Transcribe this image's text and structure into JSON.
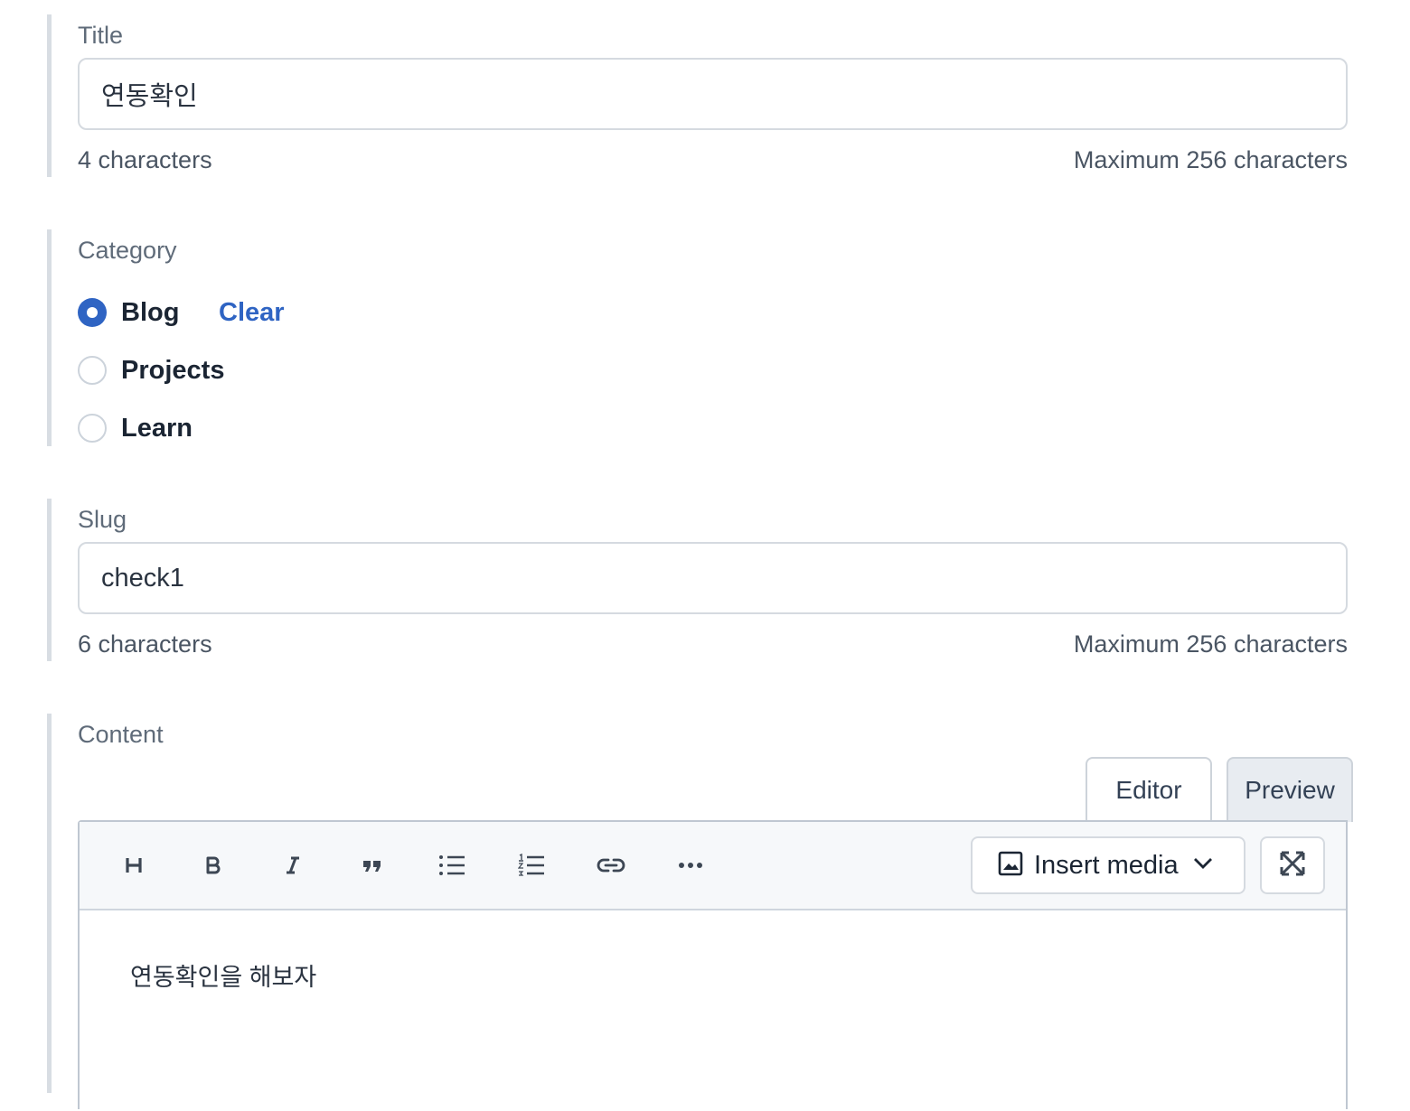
{
  "title_field": {
    "label": "Title",
    "value": "연동확인",
    "count": "4 characters",
    "max": "Maximum 256 characters"
  },
  "category_field": {
    "label": "Category",
    "options": [
      {
        "label": "Blog",
        "checked": true
      },
      {
        "label": "Projects",
        "checked": false
      },
      {
        "label": "Learn",
        "checked": false
      }
    ],
    "clear_label": "Clear"
  },
  "slug_field": {
    "label": "Slug",
    "value": "check1",
    "count": "6 characters",
    "max": "Maximum 256 characters"
  },
  "content_field": {
    "label": "Content",
    "tabs": [
      {
        "label": "Editor",
        "active": false
      },
      {
        "label": "Preview",
        "active": true
      }
    ],
    "toolbar": {
      "buttons": [
        "heading-icon",
        "bold-icon",
        "italic-icon",
        "quote-icon",
        "bullet-list-icon",
        "numbered-list-icon",
        "link-icon",
        "more-icon"
      ],
      "insert_media_label": "Insert media"
    },
    "body": "연동확인을  해보자"
  },
  "colors": {
    "accent": "#2f64c3",
    "border": "#d5dae0",
    "label": "#5f6b79",
    "field_rule": "#d8dde3"
  }
}
